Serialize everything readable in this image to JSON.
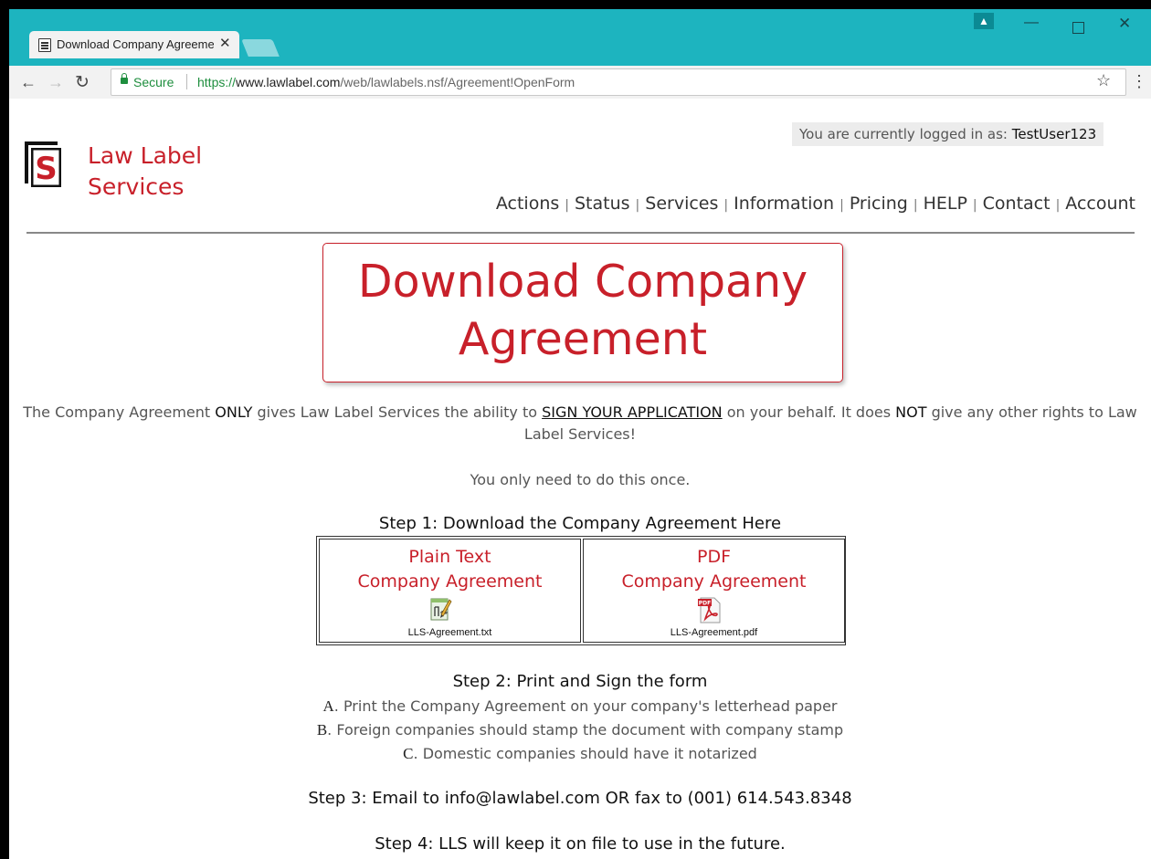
{
  "browser": {
    "tab_title": "Download Company Agreement",
    "tab_close": "✕",
    "secure_label": "Secure",
    "url_scheme": "https://",
    "url_host": "www.lawlabel.com",
    "url_path": "/web/lawlabels.nsf/Agreement!OpenForm"
  },
  "header": {
    "login_prefix": "You are currently logged in as:",
    "username": "TestUser123",
    "logo_line1": "Law Label",
    "logo_line2": "Services",
    "logo_letter": "S",
    "nav": [
      "Actions",
      "Status",
      "Services",
      "Information",
      "Pricing",
      "HELP",
      "Contact",
      "Account"
    ],
    "nav_separator": "|"
  },
  "main": {
    "title_line1": "Download Company",
    "title_line2": "Agreement",
    "intro_1": "The Company Agreement ",
    "intro_only": "ONLY",
    "intro_2": " gives Law Label Services the ability to ",
    "intro_sign": "SIGN YOUR APPLICATION",
    "intro_3": " on your behalf. It does ",
    "intro_not": "NOT",
    "intro_4": " give any other rights to Law Label Services!",
    "once": "You only need to do this once.",
    "step1": "Step 1: Download the Company Agreement Here",
    "downloads": [
      {
        "line1": "Plain Text",
        "line2": "Company Agreement",
        "file": "LLS-Agreement.txt",
        "icon": "notepad-plus-icon"
      },
      {
        "line1": "PDF",
        "line2": "Company Agreement",
        "file": "LLS-Agreement.pdf",
        "icon": "pdf-icon"
      }
    ],
    "step2": "Step 2: Print and Sign the form",
    "items": [
      {
        "letter": "A",
        "text": ". Print the Company Agreement on your company's letterhead paper"
      },
      {
        "letter": "B",
        "text": ". Foreign companies should stamp the document with company stamp"
      },
      {
        "letter": "C",
        "text": ". Domestic companies should have it notarized"
      }
    ],
    "step3": "Step 3: Email to info@lawlabel.com OR fax to (001) 614.543.8348",
    "step4": "Step 4: LLS will keep it on file to use in the future."
  },
  "colors": {
    "brand_red": "#c8202a",
    "tabstrip": "#1db4bf",
    "secure_green": "#1e8e3e"
  }
}
